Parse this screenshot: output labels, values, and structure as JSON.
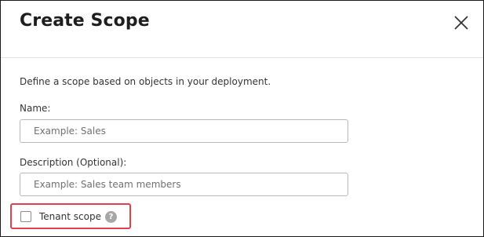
{
  "dialog": {
    "title": "Create Scope",
    "close_icon": "close-icon",
    "intro": "Define a scope based on objects in your deployment."
  },
  "form": {
    "name_label": "Name:",
    "name_placeholder": "Example: Sales",
    "name_value": "",
    "description_label": "Description (Optional):",
    "description_placeholder": "Example: Sales team members",
    "description_value": "",
    "tenant_checkbox_label": "Tenant scope",
    "tenant_checked": false,
    "help_icon": "question-mark-icon",
    "help_glyph": "?"
  },
  "colors": {
    "highlight_border": "#e0404b",
    "help_icon_bg": "#a7a7a7"
  }
}
